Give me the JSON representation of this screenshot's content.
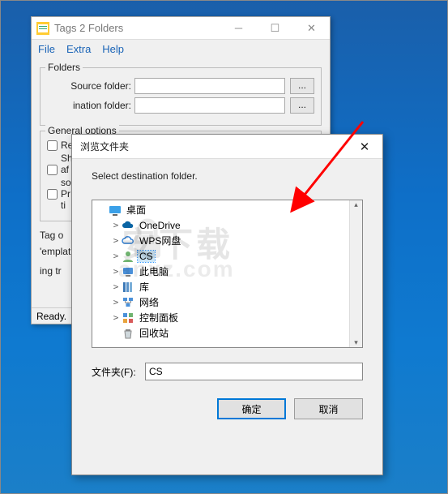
{
  "parent": {
    "title": "Tags 2 Folders",
    "menu": {
      "file": "File",
      "extra": "Extra",
      "help": "Help"
    },
    "folders_legend": "Folders",
    "source_label": "Source folder:",
    "dest_label": "ination folder:",
    "dots": "...",
    "general_legend": "General options",
    "cb_re": "Re",
    "cb_sh": "Sh",
    "cb_af": "af",
    "cb_so": "so",
    "cb_pr_line1": "Pr",
    "cb_pr_line2": "ti",
    "tag_label": "Tag o",
    "template_label": "'emplat",
    "ingtr_label": "ing tr",
    "status": "Ready."
  },
  "dialog": {
    "title": "浏览文件夹",
    "message": "Select destination folder.",
    "folder_label": "文件夹(F):",
    "folder_value": "CS",
    "ok": "确定",
    "cancel": "取消",
    "tree": [
      {
        "indent": 0,
        "twisty": "",
        "icon": "desktop",
        "label": "桌面",
        "selected": false
      },
      {
        "indent": 1,
        "twisty": ">",
        "icon": "cloud-blue",
        "label": "OneDrive",
        "selected": false
      },
      {
        "indent": 1,
        "twisty": ">",
        "icon": "cloud-outline",
        "label": "WPS网盘",
        "selected": false
      },
      {
        "indent": 1,
        "twisty": ">",
        "icon": "user",
        "label": "CS",
        "selected": true
      },
      {
        "indent": 1,
        "twisty": ">",
        "icon": "pc",
        "label": "此电脑",
        "selected": false
      },
      {
        "indent": 1,
        "twisty": ">",
        "icon": "lib",
        "label": "库",
        "selected": false
      },
      {
        "indent": 1,
        "twisty": ">",
        "icon": "network",
        "label": "网络",
        "selected": false
      },
      {
        "indent": 1,
        "twisty": ">",
        "icon": "panel",
        "label": "控制面板",
        "selected": false
      },
      {
        "indent": 1,
        "twisty": "",
        "icon": "recycle",
        "label": "回收站",
        "selected": false
      }
    ]
  },
  "watermark": {
    "main": "安下载",
    "sub": "anxz.com"
  }
}
